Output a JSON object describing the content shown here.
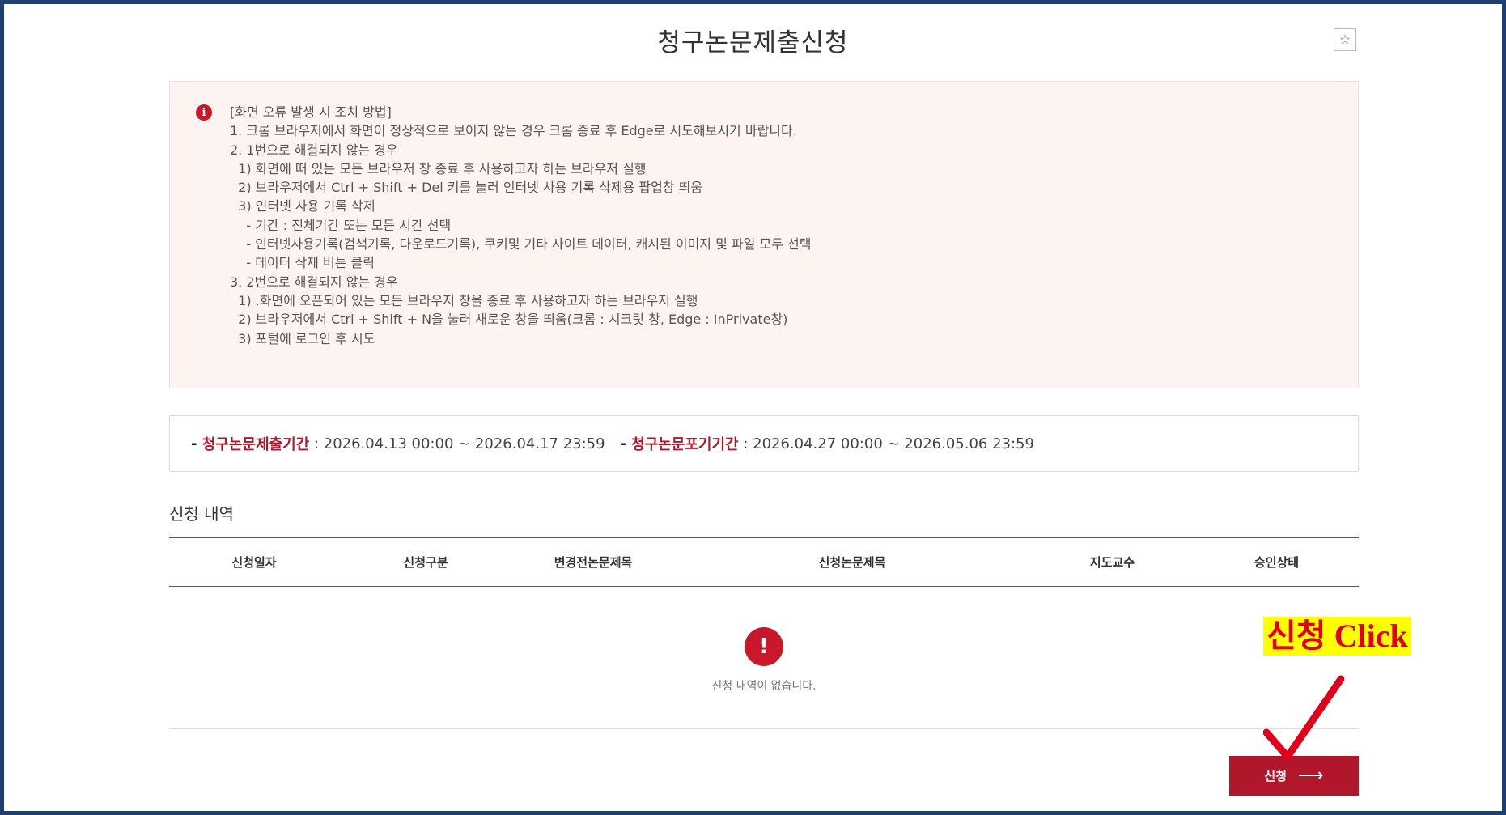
{
  "page": {
    "title": "청구논문제출신청",
    "favorite_icon": "☆"
  },
  "notice": {
    "icon": "i",
    "lines": [
      "[화면 오류 발생 시 조치 방법]",
      "1. 크롬 브라우저에서 화면이 정상적으로 보이지 않는 경우 크롬 종료 후 Edge로 시도해보시기 바랍니다.",
      "2. 1번으로 해결되지 않는 경우",
      "  1) 화면에 떠 있는 모든 브라우저 창 종료 후 사용하고자 하는 브라우저 실행",
      "  2) 브라우저에서 Ctrl + Shift + Del 키를 눌러 인터넷 사용 기록 삭제용 팝업창 띄움",
      "  3) 인터넷 사용 기록 삭제",
      "    - 기간 : 전체기간 또는 모든 시간 선택",
      "    - 인터넷사용기록(검색기록, 다운로드기록), 쿠키및 기타 사이트 데이터, 캐시된 이미지 및 파일 모두 선택",
      "    - 데이터 삭제 버튼 클릭",
      "3. 2번으로 해결되지 않는 경우",
      "  1) .화면에 오픈되어 있는 모든 브라우저 창을 종료 후 사용하고자 하는 브라우저 실행",
      "  2) 브라우저에서 Ctrl + Shift + N을 눌러 새로운 창을 띄움(크롬 : 시크릿 창, Edge : InPrivate창)",
      "  3) 포털에 로그인 후 시도"
    ]
  },
  "period": {
    "submit_label": "청구논문제출기간",
    "submit_value": " : 2026.04.13 00:00 ~ 2026.04.17 23:59",
    "withdraw_label": "청구논문포기기간",
    "withdraw_value": " : 2026.04.27 00:00 ~ 2026.05.06 23:59"
  },
  "history": {
    "title": "신청 내역",
    "columns": [
      "신청일자",
      "신청구분",
      "변경전논문제목",
      "신청논문제목",
      "지도교수",
      "승인상태"
    ],
    "empty_icon": "!",
    "empty_text": "신청 내역이 없습니다."
  },
  "apply_button": {
    "label": "신청",
    "arrow": "⟶"
  },
  "annotation": {
    "label": "신청 Click",
    "color": "#e0001b",
    "highlight": "#ffff00"
  },
  "colors": {
    "accent": "#b1172b",
    "frame": "#1f3f73",
    "notice_bg": "#fdf3f1"
  }
}
